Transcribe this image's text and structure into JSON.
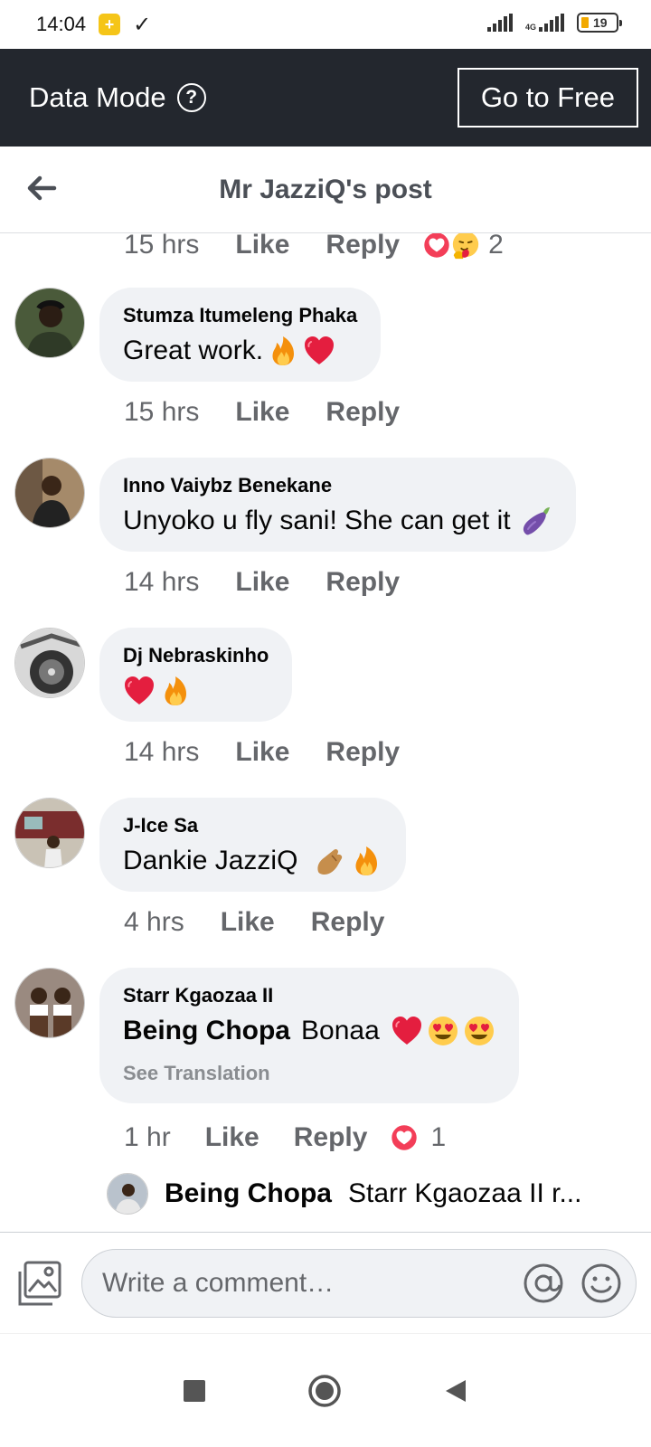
{
  "status_bar": {
    "time": "14:04",
    "network": "4G",
    "battery": "19"
  },
  "data_bar": {
    "label": "Data Mode",
    "go_free": "Go to Free"
  },
  "header": {
    "title": "Mr JazziQ's post"
  },
  "top_meta": {
    "time": "15 hrs",
    "like": "Like",
    "reply": "Reply",
    "reaction_count": "2"
  },
  "comments": [
    {
      "name": "Stumza Itumeleng Phaka",
      "text": "Great work.",
      "time": "15 hrs",
      "like": "Like",
      "reply": "Reply"
    },
    {
      "name": "Inno Vaiybz Benekane",
      "text": "Unyoko u fly sani! She can get it",
      "time": "14 hrs",
      "like": "Like",
      "reply": "Reply"
    },
    {
      "name": "Dj Nebraskinho",
      "text": "",
      "time": "14 hrs",
      "like": "Like",
      "reply": "Reply"
    },
    {
      "name": "J-Ice Sa",
      "text": "Dankie JazziQ",
      "time": "4 hrs",
      "like": "Like",
      "reply": "Reply"
    },
    {
      "name": "Starr Kgaozaa II",
      "mention": "Being Chopa",
      "text": "Bonaa",
      "see_translation": "See Translation",
      "time": "1 hr",
      "like": "Like",
      "reply": "Reply",
      "reaction_count": "1"
    }
  ],
  "reply_preview": {
    "name": "Being Chopa",
    "text": "Starr Kgaozaa II r..."
  },
  "composer": {
    "placeholder": "Write a comment…"
  },
  "icons": {
    "back": "arrow-left-icon",
    "help": "question-circle-icon",
    "gallery": "image-icon",
    "mention": "at-icon",
    "emoji": "smile-icon",
    "nav_recent": "square-icon",
    "nav_home": "circle-icon",
    "nav_back": "triangle-back-icon"
  },
  "colors": {
    "data_bar": "#23272e",
    "bubble": "#f0f2f5",
    "meta_text": "#65676b",
    "heart": "#e41e3f"
  }
}
